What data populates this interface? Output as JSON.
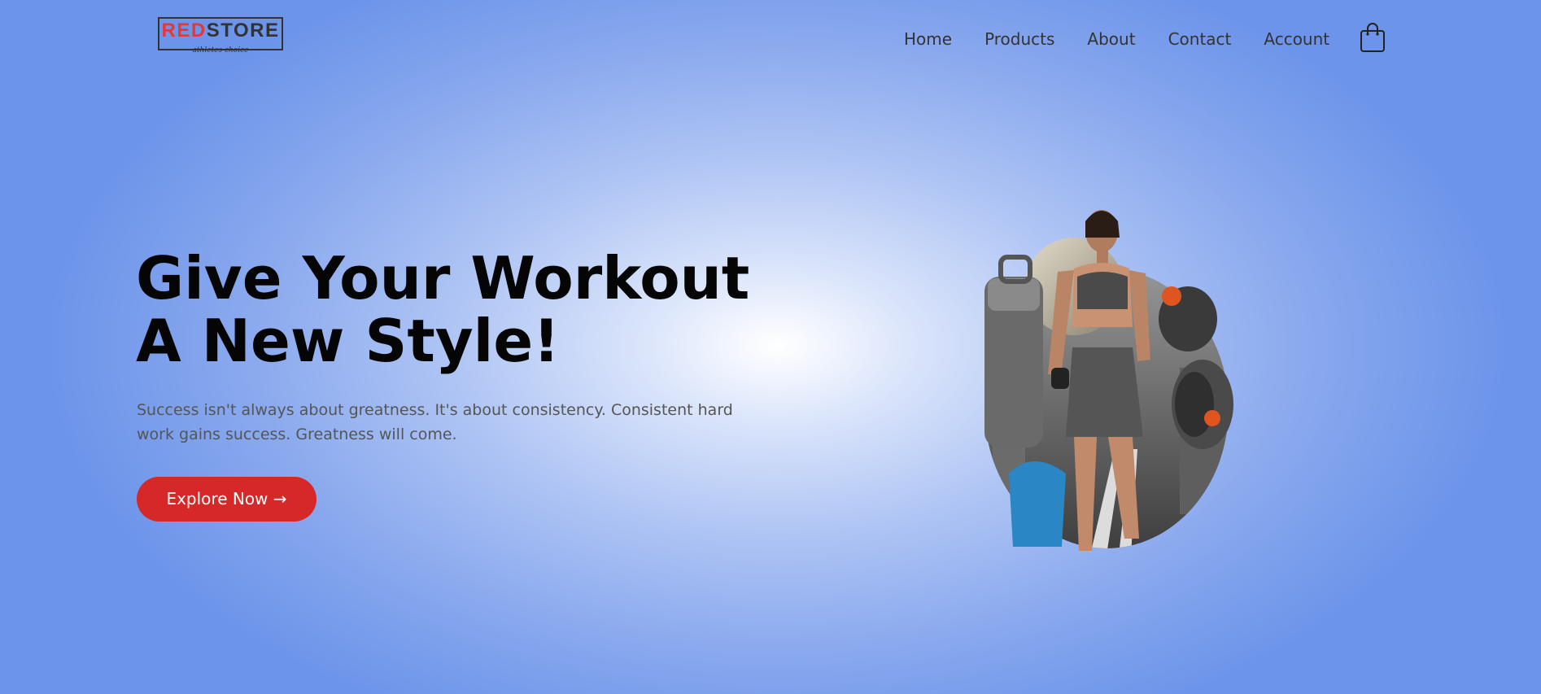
{
  "header": {
    "logo": {
      "red_text": "RED",
      "dark_text": "STORE",
      "tagline": "athletes choice"
    },
    "nav": {
      "items": [
        "Home",
        "Products",
        "About",
        "Contact",
        "Account"
      ]
    },
    "cart_icon": "shopping-bag-icon"
  },
  "hero": {
    "title_line1": "Give Your Workout",
    "title_line2": "A New Style!",
    "text": "Success isn't always about greatness. It's about consistency. Consistent hard work gains success. Greatness will come.",
    "button_label": "Explore Now →",
    "image": "fitness-model-image"
  },
  "colors": {
    "accent": "#d62828",
    "logo_red": "#e53935",
    "background_center": "#ffffff",
    "background_edge": "#6c94ea",
    "title": "#050505",
    "body_text": "#555555"
  }
}
